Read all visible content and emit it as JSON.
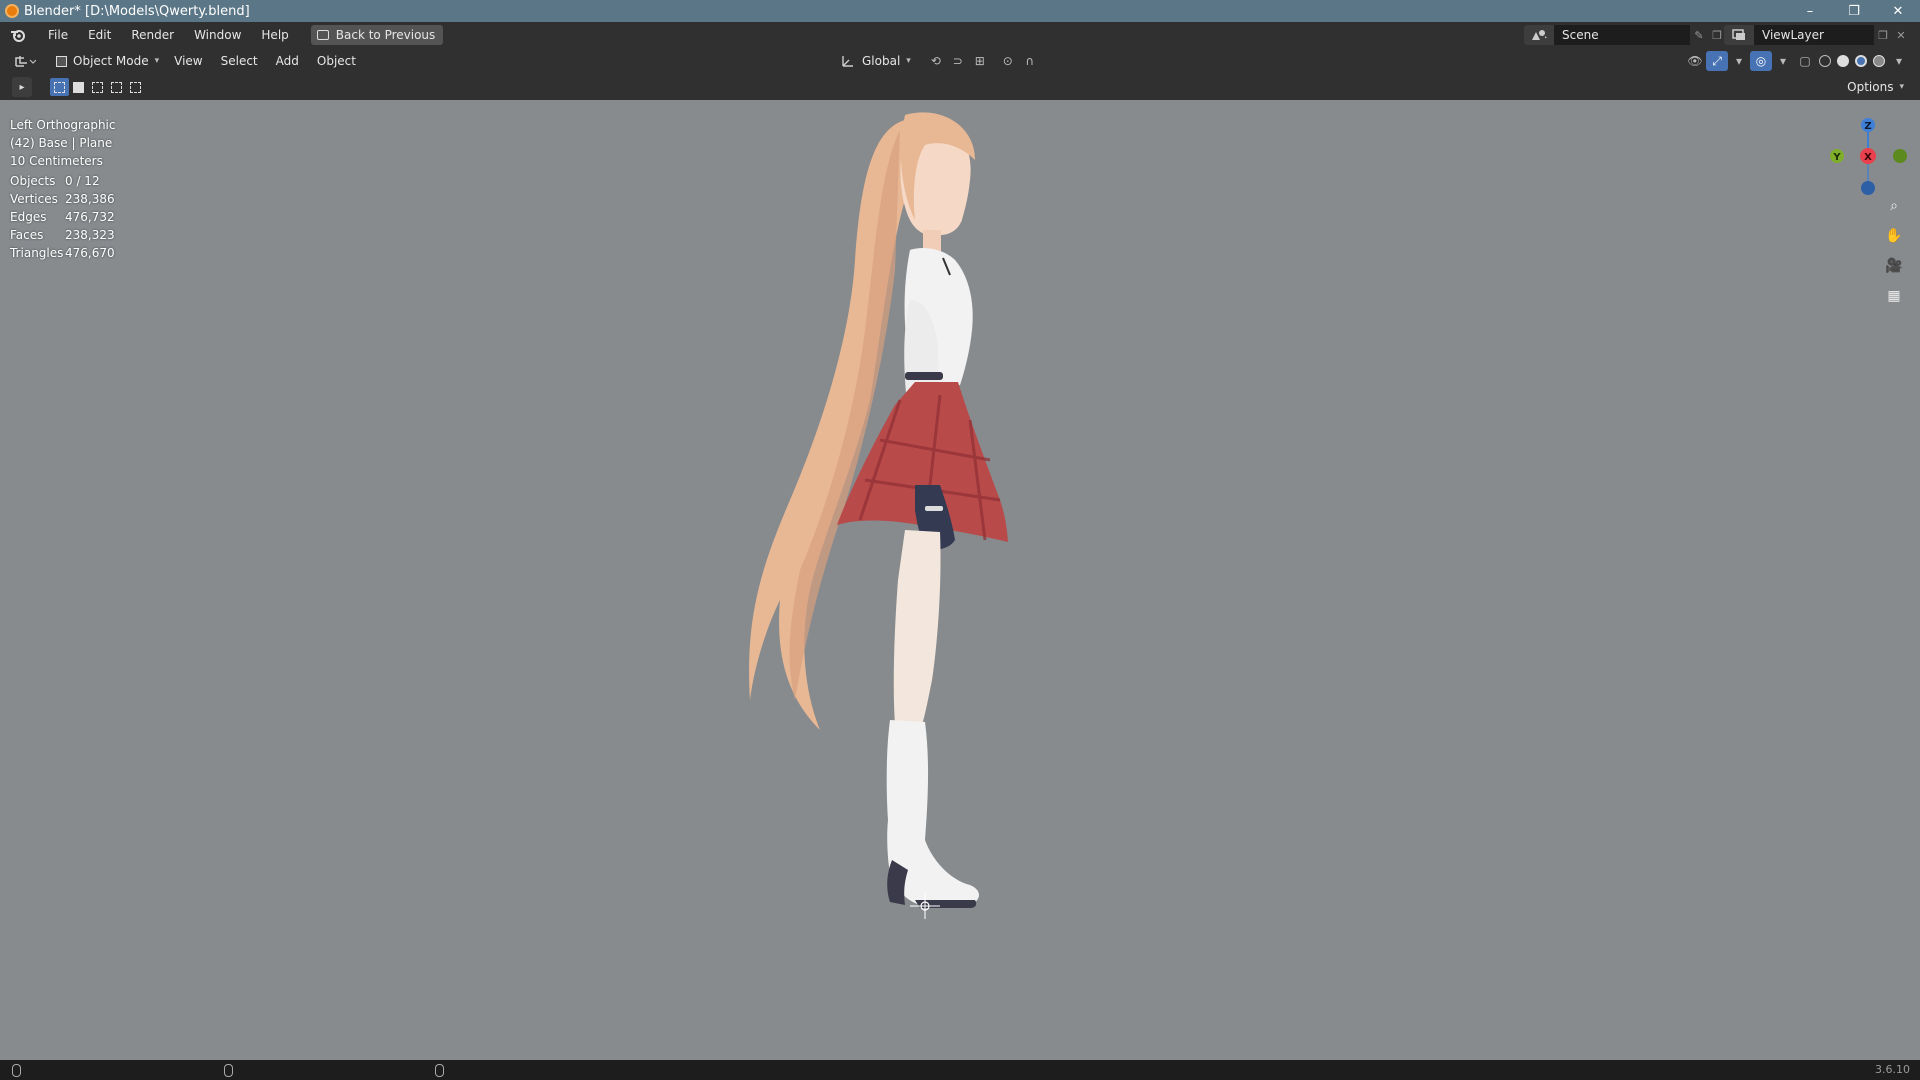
{
  "window": {
    "title": "Blender* [D:\\Models\\Qwerty.blend]",
    "controls": [
      "–",
      "❐",
      "✕"
    ]
  },
  "menubar": {
    "items": [
      "File",
      "Edit",
      "Render",
      "Window",
      "Help"
    ],
    "back_button": "Back to Previous",
    "scene": "Scene",
    "view_layer": "ViewLayer"
  },
  "viewport_header": {
    "mode": "Object Mode",
    "menus": [
      "View",
      "Select",
      "Add",
      "Object"
    ],
    "orientation": "Global"
  },
  "tool_header": {
    "options": "Options"
  },
  "viewport": {
    "view_name": "Left Orthographic",
    "collection": "(42) Base | Plane",
    "grid_scale": "10 Centimeters",
    "stats": [
      {
        "label": "Objects",
        "value": "0 / 12"
      },
      {
        "label": "Vertices",
        "value": "238,386"
      },
      {
        "label": "Edges",
        "value": "476,732"
      },
      {
        "label": "Faces",
        "value": "238,323"
      },
      {
        "label": "Triangles",
        "value": "476,670"
      }
    ],
    "gizmo": {
      "z": "Z",
      "y": "Y",
      "x": "X"
    }
  },
  "statusbar": {
    "version": "3.6.10"
  },
  "colors": {
    "titlebar": "#5b7686",
    "viewport_bg": "#878b8e",
    "accent": "#4772b3",
    "axis_x": "#e8404c",
    "axis_y": "#7fae2a",
    "axis_z": "#3f7fd6"
  }
}
